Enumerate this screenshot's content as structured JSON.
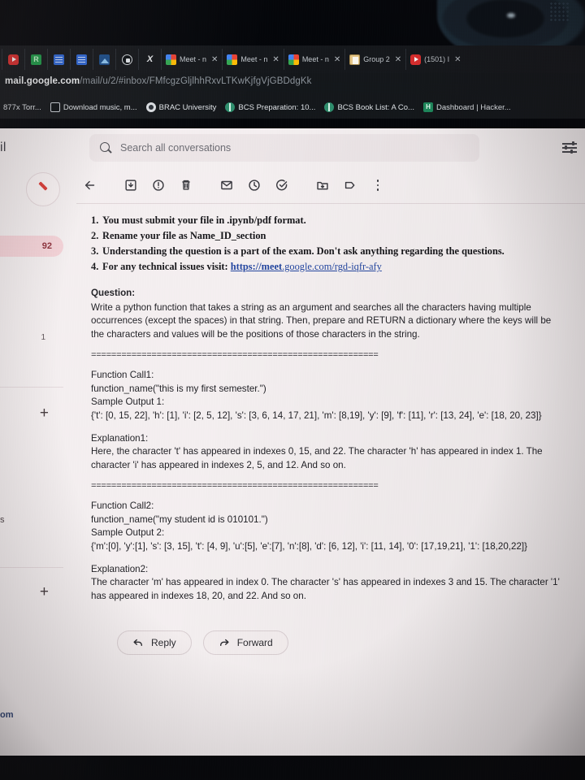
{
  "browser": {
    "tabs": [
      {
        "title": "",
        "icon": "youtube-icon",
        "pinned": true,
        "closable": false
      },
      {
        "title": "",
        "icon": "sheets-icon",
        "pinned": true,
        "closable": false
      },
      {
        "title": "",
        "icon": "docs-icon",
        "pinned": true,
        "closable": false
      },
      {
        "title": "",
        "icon": "docs-icon",
        "pinned": true,
        "closable": false
      },
      {
        "title": "",
        "icon": "image-icon",
        "pinned": true,
        "closable": false
      },
      {
        "title": "",
        "icon": "lock-icon",
        "pinned": true,
        "closable": false
      },
      {
        "title": "",
        "icon": "x-icon",
        "pinned": true,
        "closable": false
      },
      {
        "title": "Meet - n",
        "icon": "meet-icon",
        "pinned": false,
        "closable": true
      },
      {
        "title": "Meet - n",
        "icon": "meet-icon",
        "pinned": false,
        "closable": true
      },
      {
        "title": "Meet - n",
        "icon": "meet-icon",
        "pinned": false,
        "closable": true
      },
      {
        "title": "Group 2",
        "icon": "group-icon",
        "pinned": false,
        "closable": true
      },
      {
        "title": "(1501) I",
        "icon": "youtube-icon",
        "pinned": false,
        "closable": true
      }
    ],
    "close_glyph": "✕",
    "address": {
      "host": "mail.google.com",
      "path": "/mail/u/2/#inbox/FMfcgzGljlhhRxvLTKwKjfgVjGBDdgKk"
    },
    "bookmarks": [
      {
        "label": "877x Torr...",
        "icon": "site-icon"
      },
      {
        "label": "Download music, m...",
        "icon": "monitor-icon"
      },
      {
        "label": "BRAC University",
        "icon": "brac-icon"
      },
      {
        "label": "BCS Preparation: 10...",
        "icon": "globe-icon"
      },
      {
        "label": "BCS Book List: A Co...",
        "icon": "globe-icon"
      },
      {
        "label": "Dashboard | Hacker...",
        "icon": "hackerrank-icon"
      }
    ]
  },
  "gmail": {
    "logo_text": "il",
    "search": {
      "placeholder": "Search all conversations",
      "value": ""
    },
    "settings_label": "Settings",
    "rail": {
      "compose_label": "Compose",
      "inbox_count": "92",
      "secondary_count": "1",
      "plus_label": "+",
      "edge_label_s": "s",
      "edge_label_om": "om"
    },
    "toolbar": [
      {
        "name": "back-button",
        "icon": "arrow-left-icon"
      },
      {
        "name": "archive-button",
        "icon": "archive-icon"
      },
      {
        "name": "report-spam-button",
        "icon": "report-spam-icon"
      },
      {
        "name": "delete-button",
        "icon": "trash-icon"
      },
      {
        "name": "mark-unread-button",
        "icon": "envelope-icon"
      },
      {
        "name": "snooze-button",
        "icon": "clock-icon"
      },
      {
        "name": "add-to-tasks-button",
        "icon": "task-check-icon"
      },
      {
        "name": "move-to-button",
        "icon": "folder-move-icon"
      },
      {
        "name": "labels-button",
        "icon": "label-icon"
      },
      {
        "name": "more-options-button",
        "icon": "more-vertical-icon"
      }
    ],
    "message": {
      "rules": [
        {
          "num": "1.",
          "text": "You must submit your file in .ipynb/pdf format."
        },
        {
          "num": "2.",
          "text": "Rename your file as Name_ID_section"
        },
        {
          "num": "3.",
          "text": "Understanding the question is a part of the exam. Don't ask anything regarding the questions."
        },
        {
          "num": "4.",
          "text": "For any technical issues visit: ",
          "link_strong": "https://meet",
          "link_rest": ".google.com/rgd-iqfr-afy"
        }
      ],
      "question_heading": "Question:",
      "question_body": "Write a python function that takes a string as an argument and searches all the characters having multiple occurrences (except the spaces) in that string. Then, prepare and RETURN a dictionary where the keys will be the characters and values will be the positions of those characters in the string.",
      "separator": "=========================================================",
      "call1_heading": "Function Call1:",
      "call1_code": "function_name(\"this is my first semester.\")",
      "sample1_heading": "Sample Output 1:",
      "sample1_output": "{'t': [0, 15, 22], 'h': [1], 'i': [2, 5, 12], 's': [3, 6, 14, 17, 21], 'm': [8,19], 'y': [9], 'f': [11], 'r': [13, 24], 'e': [18, 20, 23]}",
      "explanation1_heading": "Explanation1:",
      "explanation1_body": "Here, the character 't' has appeared in indexes 0, 15, and 22. The character 'h' has appeared in index 1. The character 'i' has appeared in indexes 2, 5, and 12. And so on.",
      "call2_heading": "Function Call2:",
      "call2_code": "function_name(\"my student id is 010101.\")",
      "sample2_heading": "Sample Output 2:",
      "sample2_output": "{'m':[0], 'y':[1], 's': [3, 15], 't': [4, 9], 'u':[5], 'e':[7], 'n':[8], 'd': [6, 12], 'i': [11, 14], '0': [17,19,21], '1': [18,20,22]}",
      "explanation2_heading": "Explanation2:",
      "explanation2_body": "The character 'm' has appeared in index 0. The character 's' has appeared in indexes 3 and 15. The character '1' has appeared in indexes 18, 20, and 22. And so on."
    },
    "actions": {
      "reply_label": "Reply",
      "forward_label": "Forward"
    }
  },
  "colors": {
    "gmail_bg": "#f4eff0",
    "chrome_bg": "#15181c",
    "accent_red": "#d93b36",
    "inbox_highlight": "#f4d3d8",
    "link_blue": "#2346a0"
  }
}
